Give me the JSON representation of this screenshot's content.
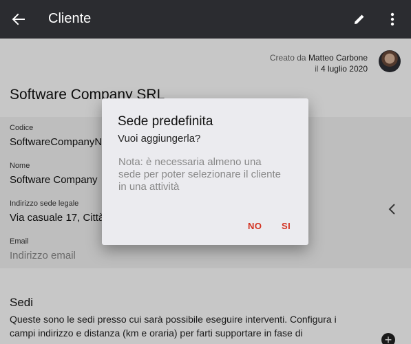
{
  "appbar": {
    "title": "Cliente",
    "icons": [
      "back-arrow-icon",
      "pencil-icon",
      "more-vert-icon"
    ]
  },
  "meta": {
    "created_prefix": "Creato da",
    "author": "Matteo Carbone",
    "date_prefix": "il",
    "date": "4 luglio 2020"
  },
  "client": {
    "name": "Software Company SRL"
  },
  "fields": {
    "codice": {
      "label": "Codice",
      "value": "SoftwareCompanyN"
    },
    "nome": {
      "label": "Nome",
      "value": "Software Company"
    },
    "indirizzo": {
      "label": "Indirizzo sede legale",
      "value": "Via casuale 17, Città"
    },
    "email": {
      "label": "Email",
      "placeholder": "Indirizzo email"
    }
  },
  "sedi": {
    "title": "Sedi",
    "description": "Queste sono le sedi presso cui sarà possibile eseguire interventi. Configura i campi indirizzo e distanza (km e oraria) per farti supportare in fase di"
  },
  "dialog": {
    "title": "Sede predefinita",
    "subtitle": "Vuoi aggiungerla?",
    "note": "Nota: è necessaria almeno una sede per poter selezionare il cliente in una attività",
    "no_label": "NO",
    "si_label": "SI"
  },
  "colors": {
    "appbar": "#2b2c30",
    "accent": "#d32f1e",
    "dialog_bg": "#ebebef"
  }
}
